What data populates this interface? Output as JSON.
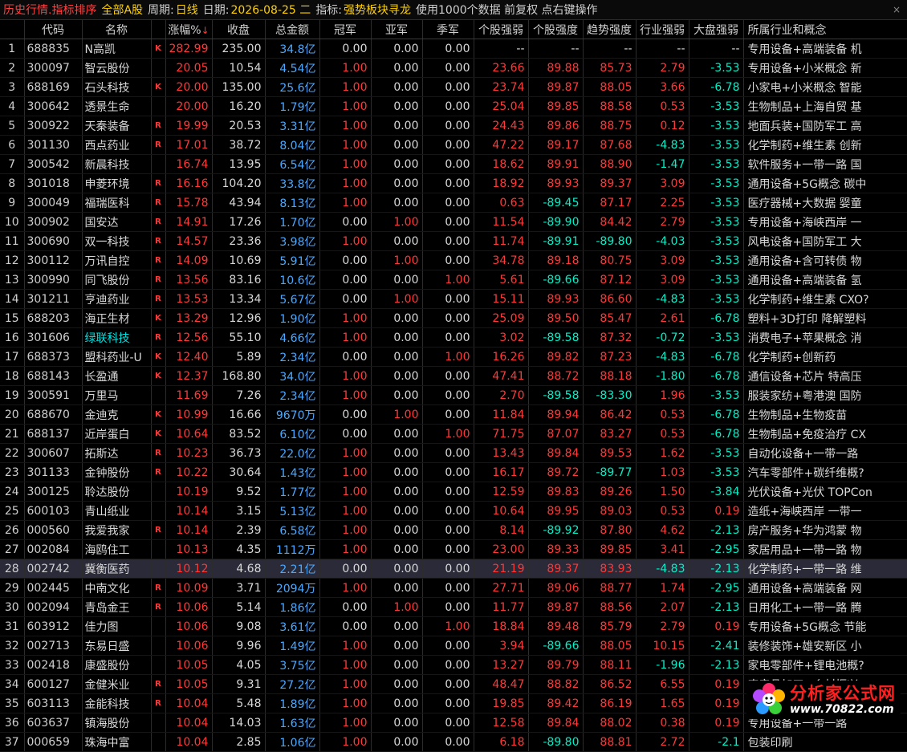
{
  "header": {
    "title": "历史行情.指标排序",
    "market": "全部A股",
    "period_label": "周期:",
    "period_value": "日线",
    "date_label": "日期:",
    "date_value": "2026-08-25 二",
    "indicator_label": "指标:",
    "indicator_value": "强势板块寻龙",
    "info": "使用1000个数据 前复权 点右键操作",
    "close": "×"
  },
  "columns": [
    "",
    "代码",
    "名称",
    "",
    "涨幅%",
    "收盘",
    "总金额",
    "冠军",
    "亚军",
    "季军",
    "个股强弱",
    "个股强度",
    "趋势强度",
    "行业强弱",
    "大盘强弱",
    "所属行业和概念"
  ],
  "sort_arrow": "↓",
  "rows": [
    [
      "1",
      "688835",
      "N高凯",
      "K",
      "282.99",
      "235.00",
      "34.8亿",
      "0.00",
      "0.00",
      "0.00",
      "--",
      "--",
      "--",
      "--",
      "--",
      "专用设备+高端装备 机"
    ],
    [
      "2",
      "300097",
      "智云股份",
      "",
      "20.05",
      "10.54",
      "4.54亿",
      "1.00",
      "0.00",
      "0.00",
      "23.66",
      "89.88",
      "85.73",
      "2.79",
      "-3.53",
      "专用设备+小米概念 新"
    ],
    [
      "3",
      "688169",
      "石头科技",
      "K",
      "20.00",
      "135.00",
      "25.6亿",
      "1.00",
      "0.00",
      "0.00",
      "23.74",
      "89.87",
      "88.05",
      "3.66",
      "-6.78",
      "小家电+小米概念 智能"
    ],
    [
      "4",
      "300642",
      "透景生命",
      "",
      "20.00",
      "16.20",
      "1.79亿",
      "1.00",
      "0.00",
      "0.00",
      "25.04",
      "89.85",
      "88.58",
      "0.53",
      "-3.53",
      "生物制品+上海自贸 基"
    ],
    [
      "5",
      "300922",
      "天秦装备",
      "R",
      "19.99",
      "20.53",
      "3.31亿",
      "1.00",
      "0.00",
      "0.00",
      "24.43",
      "89.86",
      "88.75",
      "0.12",
      "-3.53",
      "地面兵装+国防军工 高"
    ],
    [
      "6",
      "301130",
      "西点药业",
      "R",
      "17.01",
      "38.72",
      "8.04亿",
      "1.00",
      "0.00",
      "0.00",
      "47.22",
      "89.17",
      "87.68",
      "-4.83",
      "-3.53",
      "化学制药+维生素 创新"
    ],
    [
      "7",
      "300542",
      "新晨科技",
      "",
      "16.74",
      "13.95",
      "6.54亿",
      "1.00",
      "0.00",
      "0.00",
      "18.62",
      "89.91",
      "88.90",
      "-1.47",
      "-3.53",
      "软件服务+一带一路 国"
    ],
    [
      "8",
      "301018",
      "申菱环境",
      "R",
      "16.16",
      "104.20",
      "33.8亿",
      "1.00",
      "0.00",
      "0.00",
      "18.92",
      "89.93",
      "89.37",
      "3.09",
      "-3.53",
      "通用设备+5G概念 碳中"
    ],
    [
      "9",
      "300049",
      "福瑞医科",
      "R",
      "15.78",
      "43.94",
      "8.13亿",
      "1.00",
      "0.00",
      "0.00",
      "0.63",
      "-89.45",
      "87.17",
      "2.25",
      "-3.53",
      "医疗器械+大数据 婴童"
    ],
    [
      "10",
      "300902",
      "国安达",
      "R",
      "14.91",
      "17.26",
      "1.70亿",
      "0.00",
      "1.00",
      "0.00",
      "11.54",
      "-89.90",
      "84.42",
      "2.79",
      "-3.53",
      "专用设备+海峡西岸 一"
    ],
    [
      "11",
      "300690",
      "双一科技",
      "R",
      "14.57",
      "23.36",
      "3.98亿",
      "1.00",
      "0.00",
      "0.00",
      "11.74",
      "-89.91",
      "-89.80",
      "-4.03",
      "-3.53",
      "风电设备+国防军工 大"
    ],
    [
      "12",
      "300112",
      "万讯自控",
      "R",
      "14.09",
      "10.69",
      "5.91亿",
      "0.00",
      "1.00",
      "0.00",
      "34.78",
      "89.18",
      "80.75",
      "3.09",
      "-3.53",
      "通用设备+含可转债 物"
    ],
    [
      "13",
      "300990",
      "同飞股份",
      "R",
      "13.56",
      "83.16",
      "10.6亿",
      "0.00",
      "0.00",
      "1.00",
      "5.61",
      "-89.66",
      "87.12",
      "3.09",
      "-3.53",
      "通用设备+高端装备 氢"
    ],
    [
      "14",
      "301211",
      "亨迪药业",
      "R",
      "13.53",
      "13.34",
      "5.67亿",
      "0.00",
      "1.00",
      "0.00",
      "15.11",
      "89.93",
      "86.60",
      "-4.83",
      "-3.53",
      "化学制药+维生素 CXO?"
    ],
    [
      "15",
      "688203",
      "海正生材",
      "K",
      "13.29",
      "12.96",
      "1.90亿",
      "1.00",
      "0.00",
      "0.00",
      "25.09",
      "89.50",
      "85.47",
      "2.61",
      "-6.78",
      "塑料+3D打印 降解塑料"
    ],
    [
      "16",
      "301606",
      "绿联科技",
      "R",
      "12.56",
      "55.10",
      "4.66亿",
      "1.00",
      "0.00",
      "0.00",
      "3.02",
      "-89.58",
      "87.32",
      "-0.72",
      "-3.53",
      "消费电子+苹果概念 消"
    ],
    [
      "17",
      "688373",
      "盟科药业-U",
      "K",
      "12.40",
      "5.89",
      "2.34亿",
      "0.00",
      "0.00",
      "1.00",
      "16.26",
      "89.82",
      "87.23",
      "-4.83",
      "-6.78",
      "化学制药+创新药"
    ],
    [
      "18",
      "688143",
      "长盈通",
      "K",
      "12.37",
      "168.80",
      "34.0亿",
      "1.00",
      "0.00",
      "0.00",
      "47.41",
      "88.72",
      "88.18",
      "-1.80",
      "-6.78",
      "通信设备+芯片 特高压"
    ],
    [
      "19",
      "300591",
      "万里马",
      "",
      "11.69",
      "7.26",
      "2.34亿",
      "1.00",
      "0.00",
      "0.00",
      "2.70",
      "-89.58",
      "-83.30",
      "1.96",
      "-3.53",
      "服装家纺+粤港澳 国防"
    ],
    [
      "20",
      "688670",
      "金迪克",
      "K",
      "10.99",
      "16.66",
      "9670万",
      "0.00",
      "1.00",
      "0.00",
      "11.84",
      "89.94",
      "86.42",
      "0.53",
      "-6.78",
      "生物制品+生物疫苗"
    ],
    [
      "21",
      "688137",
      "近岸蛋白",
      "K",
      "10.64",
      "83.52",
      "6.10亿",
      "0.00",
      "0.00",
      "1.00",
      "71.75",
      "87.07",
      "83.27",
      "0.53",
      "-6.78",
      "生物制品+免疫治疗 CX"
    ],
    [
      "22",
      "300607",
      "拓斯达",
      "R",
      "10.23",
      "36.73",
      "22.0亿",
      "1.00",
      "0.00",
      "0.00",
      "13.43",
      "89.84",
      "89.53",
      "1.62",
      "-3.53",
      "自动化设备+一带一路"
    ],
    [
      "23",
      "301133",
      "金钟股份",
      "R",
      "10.22",
      "30.64",
      "1.43亿",
      "1.00",
      "0.00",
      "0.00",
      "16.17",
      "89.72",
      "-89.77",
      "1.03",
      "-3.53",
      "汽车零部件+碳纤维概?"
    ],
    [
      "24",
      "300125",
      "聆达股份",
      "",
      "10.19",
      "9.52",
      "1.77亿",
      "1.00",
      "0.00",
      "0.00",
      "12.59",
      "89.83",
      "89.26",
      "1.50",
      "-3.84",
      "光伏设备+光伏 TOPCon"
    ],
    [
      "25",
      "600103",
      "青山纸业",
      "",
      "10.14",
      "3.15",
      "5.13亿",
      "1.00",
      "0.00",
      "0.00",
      "10.64",
      "89.95",
      "89.03",
      "0.53",
      "0.19",
      "造纸+海峡西岸 一带一"
    ],
    [
      "26",
      "000560",
      "我爱我家",
      "R",
      "10.14",
      "2.39",
      "6.58亿",
      "1.00",
      "0.00",
      "0.00",
      "8.14",
      "-89.92",
      "87.80",
      "4.62",
      "-2.13",
      "房产服务+华为鸿蒙 物"
    ],
    [
      "27",
      "002084",
      "海鸥住工",
      "",
      "10.13",
      "4.35",
      "1112万",
      "1.00",
      "0.00",
      "0.00",
      "23.00",
      "89.33",
      "89.85",
      "3.41",
      "-2.95",
      "家居用品+一带一路 物"
    ],
    [
      "28",
      "002742",
      "冀衡医药",
      "",
      "10.12",
      "4.68",
      "2.21亿",
      "0.00",
      "0.00",
      "0.00",
      "21.19",
      "89.37",
      "83.93",
      "-4.83",
      "-2.13",
      "化学制药+一带一路 维"
    ],
    [
      "29",
      "002445",
      "中南文化",
      "R",
      "10.09",
      "3.71",
      "2094万",
      "1.00",
      "0.00",
      "0.00",
      "27.71",
      "89.06",
      "88.77",
      "1.74",
      "-2.95",
      "通用设备+高端装备 网"
    ],
    [
      "30",
      "002094",
      "青岛金王",
      "R",
      "10.06",
      "5.14",
      "1.86亿",
      "0.00",
      "1.00",
      "0.00",
      "11.77",
      "89.87",
      "88.56",
      "2.07",
      "-2.13",
      "日用化工+一带一路 腾"
    ],
    [
      "31",
      "603912",
      "佳力图",
      "",
      "10.06",
      "9.08",
      "3.61亿",
      "0.00",
      "0.00",
      "1.00",
      "18.84",
      "89.48",
      "85.79",
      "2.79",
      "0.19",
      "专用设备+5G概念 节能"
    ],
    [
      "32",
      "002713",
      "东易日盛",
      "",
      "10.06",
      "9.96",
      "1.49亿",
      "1.00",
      "0.00",
      "0.00",
      "3.94",
      "-89.66",
      "88.05",
      "10.15",
      "-2.41",
      "装修装饰+雄安新区 小"
    ],
    [
      "33",
      "002418",
      "康盛股份",
      "",
      "10.05",
      "4.05",
      "3.75亿",
      "1.00",
      "0.00",
      "0.00",
      "13.27",
      "89.79",
      "88.11",
      "-1.96",
      "-2.13",
      "家电零部件+锂电池概?"
    ],
    [
      "34",
      "600127",
      "金健米业",
      "R",
      "10.05",
      "9.31",
      "27.2亿",
      "1.00",
      "0.00",
      "0.00",
      "48.47",
      "88.82",
      "86.52",
      "6.55",
      "0.19",
      "农产品加工+乡村振兴"
    ],
    [
      "35",
      "603113",
      "金能科技",
      "R",
      "10.04",
      "5.48",
      "1.89亿",
      "1.00",
      "0.00",
      "0.00",
      "19.85",
      "89.42",
      "86.19",
      "1.65",
      "0.19",
      "化学原料+光伏 氢能源"
    ],
    [
      "36",
      "603637",
      "镇海股份",
      "",
      "10.04",
      "14.03",
      "1.63亿",
      "1.00",
      "0.00",
      "0.00",
      "12.58",
      "89.84",
      "88.02",
      "0.38",
      "0.19",
      "专用设备+一带一路"
    ],
    [
      "37",
      "000659",
      "珠海中富",
      "",
      "10.04",
      "2.85",
      "1.06亿",
      "1.00",
      "0.00",
      "0.00",
      "6.18",
      "-89.80",
      "88.81",
      "2.72",
      "-2.1",
      "包装印刷"
    ]
  ],
  "selected_row": 28,
  "green_name_rows": [
    16
  ],
  "logo": {
    "main": "分析家公式网",
    "url": "www.70822.com"
  },
  "colors": {
    "red": "#ff3838",
    "cyan": "#00f0c8",
    "blue": "#4aa8ff",
    "yellow": "#ffd000"
  }
}
